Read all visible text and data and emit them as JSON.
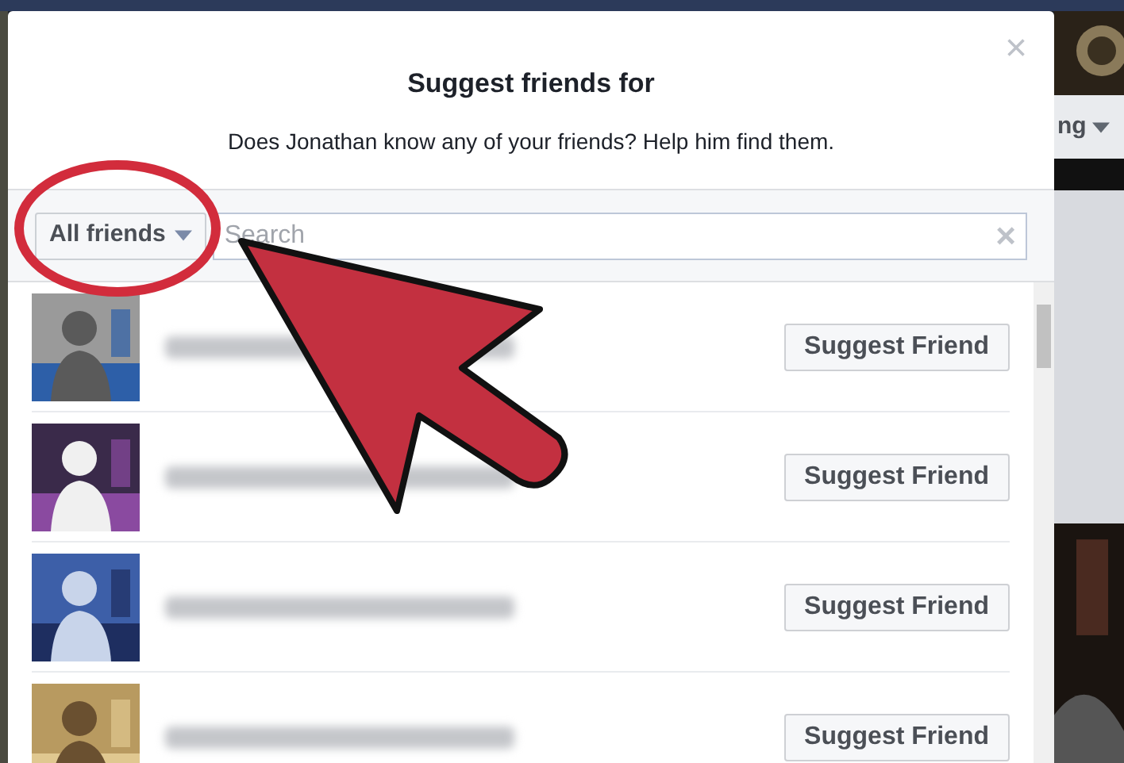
{
  "background": {
    "partial_text": "ng"
  },
  "dialog": {
    "title": "Suggest friends for",
    "subtitle": "Does Jonathan know any of your friends? Help him find them.",
    "close": "×"
  },
  "filter": {
    "label": "All friends",
    "search": {
      "placeholder": "Search",
      "clear": "×"
    }
  },
  "friends": [
    {
      "action": "Suggest Friend"
    },
    {
      "action": "Suggest Friend"
    },
    {
      "action": "Suggest Friend"
    },
    {
      "action": "Suggest Friend"
    }
  ]
}
